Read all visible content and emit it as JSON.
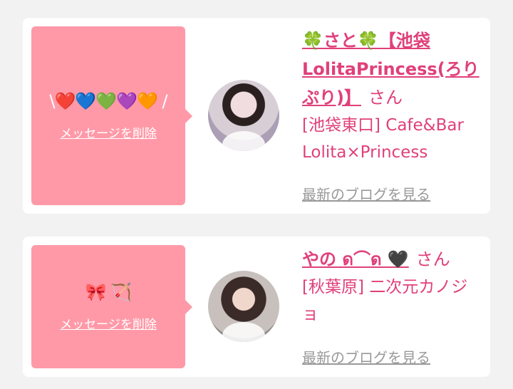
{
  "cards": [
    {
      "message": "\\❤️💙💚💜🧡 /",
      "delete_label": "メッセージを削除",
      "name": "🍀さと🍀【池袋LolitaPrincess(ろりぷり)】",
      "honorific": "さん",
      "shop_line": "[池袋東口] Cafe&Bar Lolita×Princess",
      "blog_label": "最新のブログを見る"
    },
    {
      "message": "🎀 🏹",
      "delete_label": "メッセージを削除",
      "name": "やの ด⌒ด 🖤",
      "honorific": "さん",
      "shop_line": "[秋葉原] 二次元カノジョ",
      "blog_label": "最新のブログを見る"
    }
  ]
}
